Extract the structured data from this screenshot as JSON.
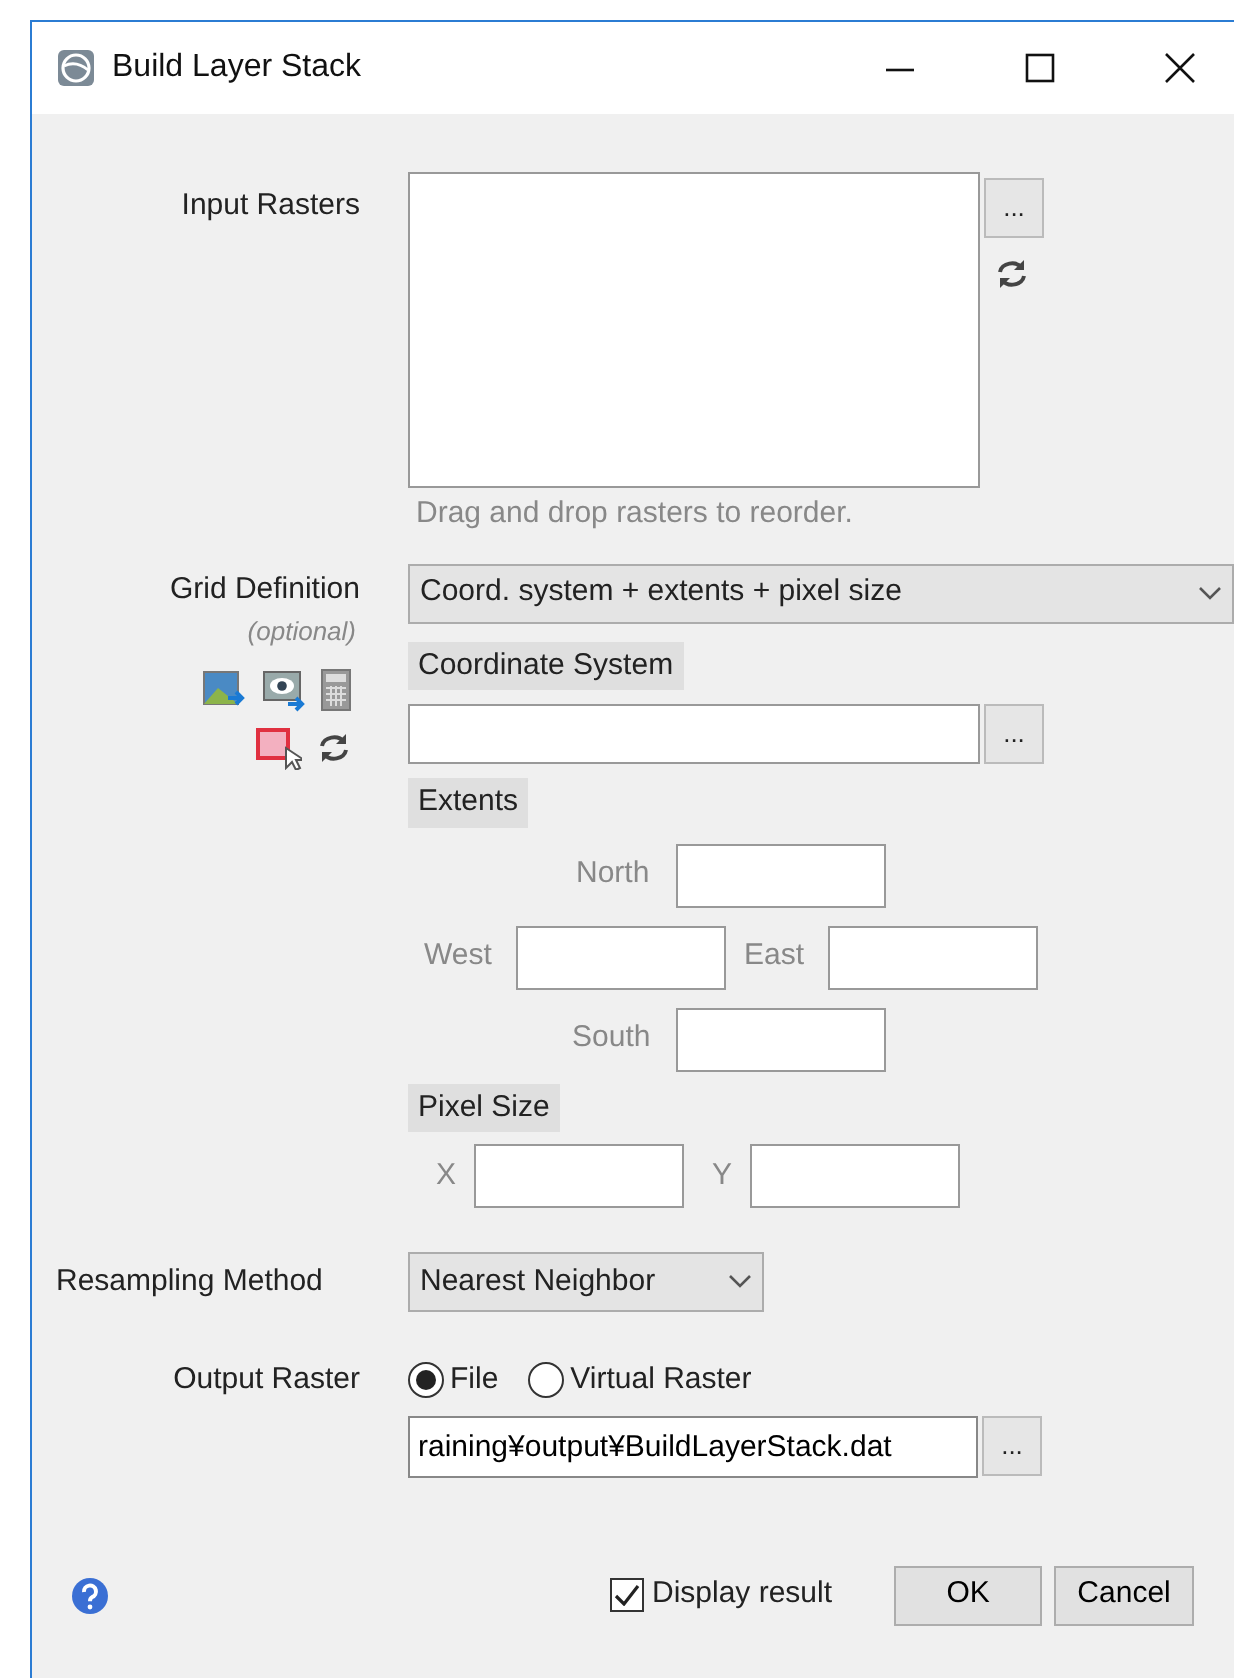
{
  "window": {
    "title": "Build Layer Stack"
  },
  "input_rasters": {
    "label": "Input Rasters",
    "browse": "...",
    "hint": "Drag and drop rasters to reorder."
  },
  "grid_definition": {
    "label": "Grid Definition",
    "optional": "(optional)",
    "mode": "Coord. system + extents + pixel size",
    "coordinate_system": {
      "label": "Coordinate System",
      "browse": "..."
    },
    "extents": {
      "label": "Extents",
      "north": "North",
      "west": "West",
      "east": "East",
      "south": "South"
    },
    "pixel_size": {
      "label": "Pixel Size",
      "x": "X",
      "y": "Y"
    }
  },
  "resampling": {
    "label": "Resampling Method",
    "value": "Nearest Neighbor"
  },
  "output_raster": {
    "label": "Output Raster",
    "options": [
      {
        "label": "File",
        "selected": true
      },
      {
        "label": "Virtual Raster",
        "selected": false
      }
    ],
    "path": "raining¥output¥BuildLayerStack.dat",
    "browse": "..."
  },
  "display_result": {
    "label": "Display result",
    "checked": true
  },
  "buttons": [
    "OK",
    "Cancel"
  ]
}
